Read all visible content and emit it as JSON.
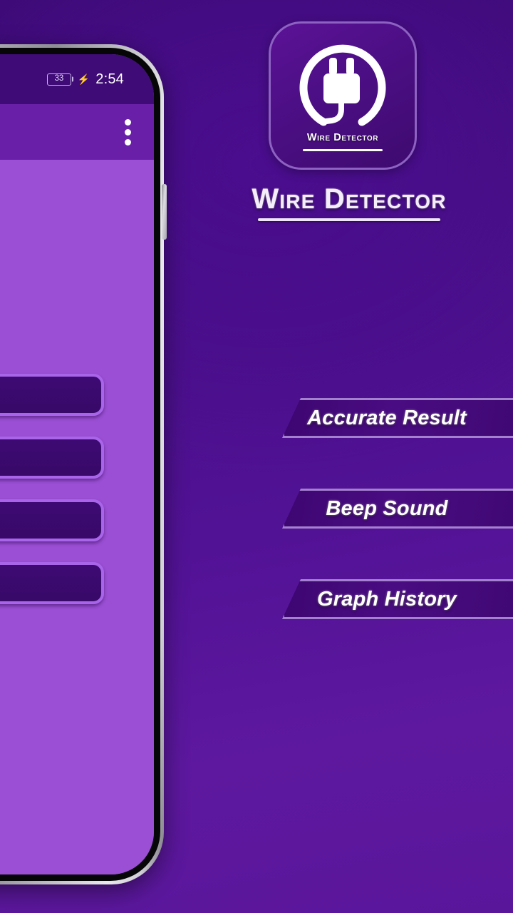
{
  "theme": {
    "bg_dark_purple": "#3b0a73",
    "bg_light_purple": "#5d189f",
    "accent_border": "#a481cf",
    "banner_fill": "#4a0c82",
    "phone_screen_purple": "#9b4fd4",
    "app_bar_purple": "#6a1fa8",
    "button_purple": "#3d0a73",
    "button_border": "#a965ea",
    "text_white": "#ffffff"
  },
  "promo": {
    "icon": {
      "glyph_name": "power-plug-in-circle-icon",
      "caption": "Wire Detector"
    },
    "app_title": "Wire Detector",
    "features": [
      {
        "label": "Accurate Result"
      },
      {
        "label": "Beep Sound"
      },
      {
        "label": "Graph History"
      }
    ]
  },
  "phone": {
    "status_bar": {
      "battery_percent": "33",
      "charging_icon": "charging-bolt-icon",
      "time": "2:54"
    },
    "app_bar": {
      "overflow_menu_icon": "kebab-menu-icon"
    },
    "content": {
      "buttons": [
        {
          "label": ""
        },
        {
          "label": ""
        },
        {
          "label": ""
        },
        {
          "label": ""
        }
      ]
    }
  }
}
